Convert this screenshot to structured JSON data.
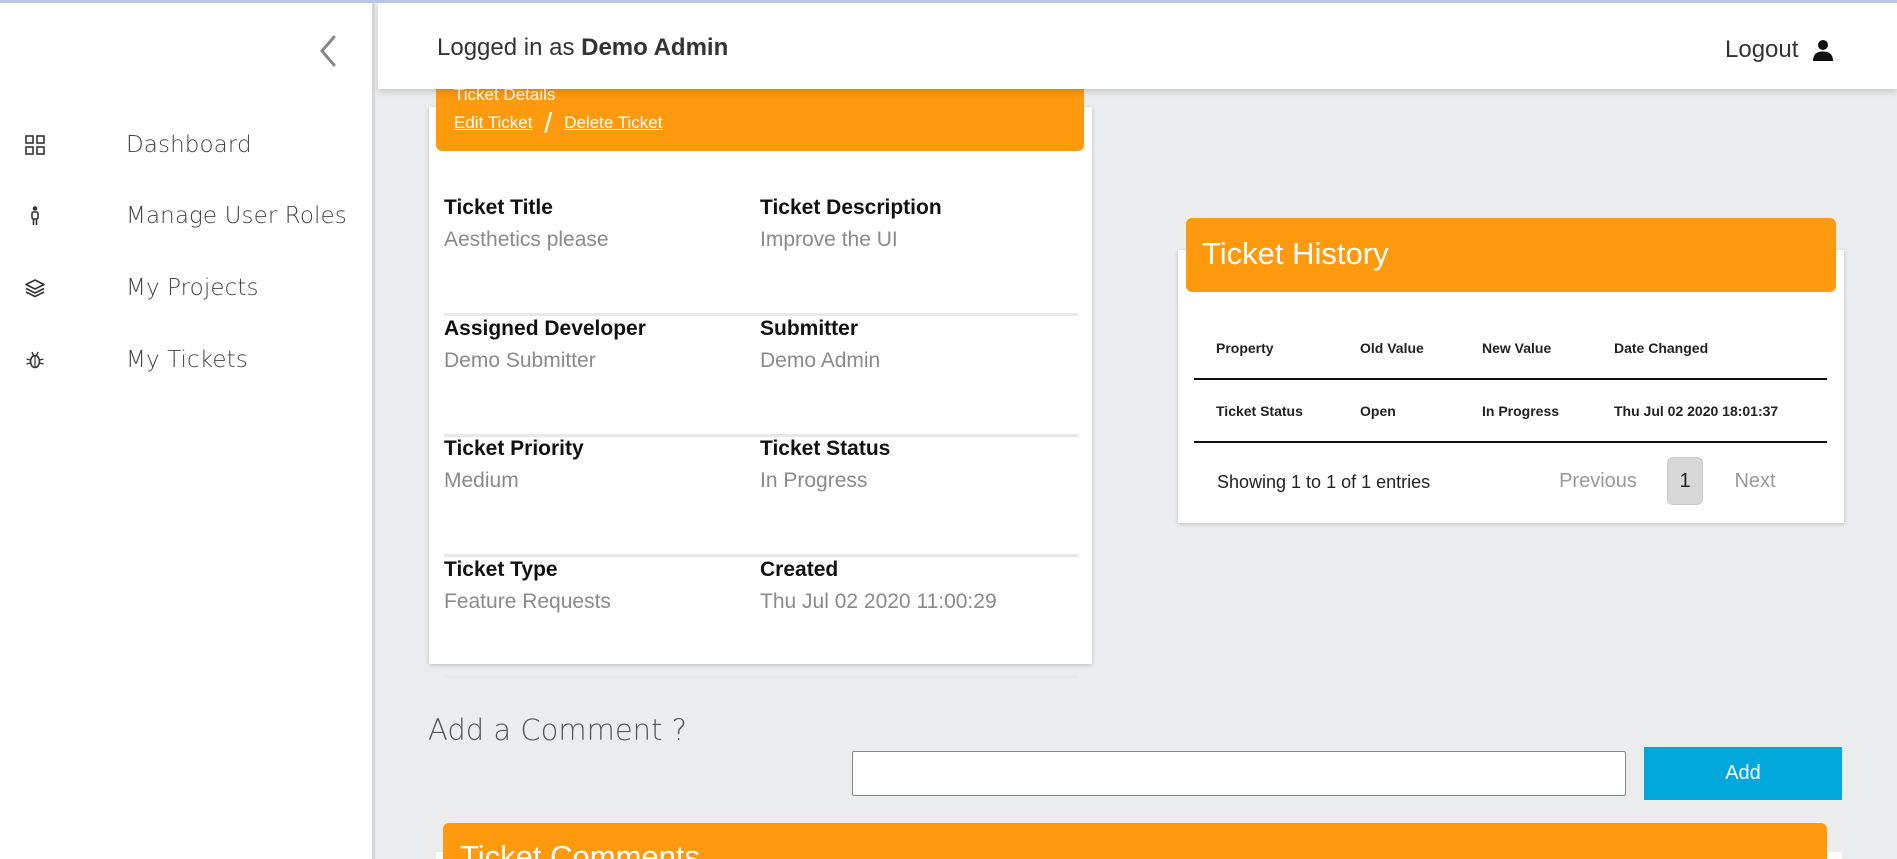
{
  "sidebar": {
    "collapse_icon": "chevron-left-icon",
    "items": [
      {
        "label": "Dashboard",
        "icon": "grid-icon"
      },
      {
        "label": "Manage User Roles",
        "icon": "person-icon"
      },
      {
        "label": "My Projects",
        "icon": "layers-icon"
      },
      {
        "label": "My Tickets",
        "icon": "bug-icon"
      }
    ]
  },
  "header": {
    "logged_prefix": "Logged in as",
    "user_name": "Demo Admin",
    "logout_label": "Logout",
    "logout_icon": "user-icon"
  },
  "details": {
    "banner_title": "Ticket Details",
    "edit_label": "Edit Ticket",
    "separator": "/",
    "delete_label": "Delete Ticket",
    "fields": [
      {
        "label": "Ticket Title",
        "value": "Aesthetics please"
      },
      {
        "label": "Ticket Description",
        "value": "Improve the UI"
      },
      {
        "label": "Assigned Developer",
        "value": "Demo Submitter"
      },
      {
        "label": "Submitter",
        "value": "Demo Admin"
      },
      {
        "label": "Ticket Priority",
        "value": "Medium"
      },
      {
        "label": "Ticket Status",
        "value": "In Progress"
      },
      {
        "label": "Ticket Type",
        "value": "Feature Requests"
      },
      {
        "label": "Created",
        "value": "Thu Jul 02 2020 11:00:29"
      }
    ]
  },
  "history": {
    "title": "Ticket History",
    "columns": [
      "Property",
      "Old Value",
      "New Value",
      "Date Changed"
    ],
    "rows": [
      [
        "Ticket Status",
        "Open",
        "In Progress",
        "Thu Jul 02 2020 18:01:37"
      ]
    ],
    "info": "Showing 1 to 1 of 1 entries",
    "previous_label": "Previous",
    "current_page": "1",
    "next_label": "Next"
  },
  "comments": {
    "heading": "Add a Comment ?",
    "input_value": "",
    "add_label": "Add",
    "section_title": "Ticket Comments"
  },
  "colors": {
    "accent_orange": "#ff9a0f",
    "button_blue": "#00a8dc"
  }
}
